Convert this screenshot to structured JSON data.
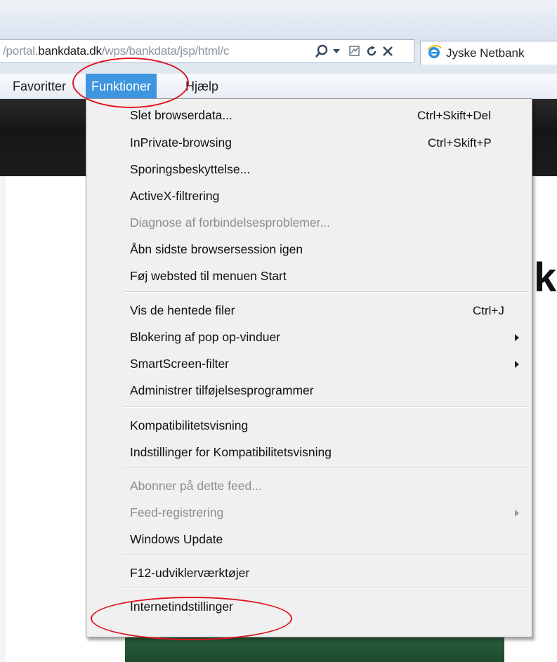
{
  "address_bar": {
    "url_prefix": "/portal.",
    "url_domain": "bankdata.dk",
    "url_rest": "/wps/bankdata/jsp/html/c",
    "icons": [
      "search-icon",
      "dropdown-arrow-icon",
      "compat-view-icon",
      "refresh-icon",
      "stop-icon"
    ]
  },
  "tab": {
    "title": "Jyske Netbank",
    "icon": "ie-logo-icon"
  },
  "menubar": {
    "favoritter": "Favoritter",
    "funktioner": "Funktioner",
    "hjaelp": "Hjælp"
  },
  "menu": {
    "items": [
      {
        "label": "Slet browserdata...",
        "shortcut": "Ctrl+Skift+Del"
      },
      {
        "label": "InPrivate-browsing",
        "shortcut": "Ctrl+Skift+P"
      },
      {
        "label": "Sporingsbeskyttelse..."
      },
      {
        "label": "ActiveX-filtrering"
      },
      {
        "label": "Diagnose af forbindelsesproblemer...",
        "disabled": true
      },
      {
        "label": "Åbn sidste browsersession igen"
      },
      {
        "label": "Føj websted til menuen Start"
      },
      {
        "label": "Vis de hentede filer",
        "shortcut": "Ctrl+J"
      },
      {
        "label": "Blokering af pop op-vinduer",
        "submenu": true
      },
      {
        "label": "SmartScreen-filter",
        "submenu": true
      },
      {
        "label": "Administrer tilføjelsesprogrammer"
      },
      {
        "label": "Kompatibilitetsvisning"
      },
      {
        "label": "Indstillinger for Kompatibilitetsvisning"
      },
      {
        "label": "Abonner på dette feed...",
        "disabled": true
      },
      {
        "label": "Feed-registrering",
        "disabled": true,
        "submenu": true
      },
      {
        "label": "Windows Update"
      },
      {
        "label": "F12-udviklerværktøjer"
      },
      {
        "label": "Internetindstillinger"
      }
    ]
  },
  "page": {
    "partial_heading": "k"
  },
  "colors": {
    "menu_highlight": "#3e95e0",
    "annotation": "#e0141e"
  }
}
